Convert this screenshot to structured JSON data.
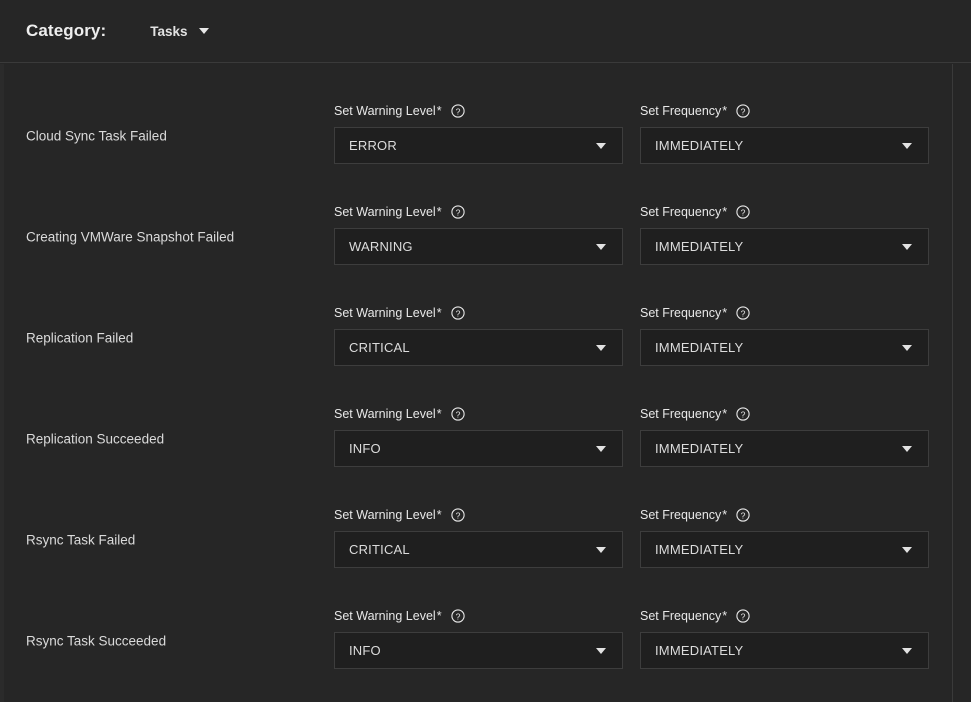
{
  "header": {
    "category_label": "Category:",
    "category_value": "Tasks",
    "caret_icon": "chevron-down-icon"
  },
  "columns": {
    "level_label": "Set Warning Level",
    "freq_label": "Set Frequency",
    "required_marker": "*",
    "help_icon": "help-circle-icon"
  },
  "colors": {
    "page_bg": "#262626",
    "field_bg": "#1f1f1f",
    "field_border": "#3d3d3d",
    "divider": "#3a3a3a",
    "text": "#dcdcdc"
  },
  "rows": [
    {
      "name": "Cloud Sync Task Failed",
      "level_label": "Set Warning Level",
      "level_value": "ERROR",
      "freq_label": "Set Frequency",
      "freq_value": "IMMEDIATELY"
    },
    {
      "name": "Creating VMWare Snapshot Failed",
      "level_label": "Set Warning Level",
      "level_value": "WARNING",
      "freq_label": "Set Frequency",
      "freq_value": "IMMEDIATELY"
    },
    {
      "name": "Replication Failed",
      "level_label": "Set Warning Level",
      "level_value": "CRITICAL",
      "freq_label": "Set Frequency",
      "freq_value": "IMMEDIATELY"
    },
    {
      "name": "Replication Succeeded",
      "level_label": "Set Warning Level",
      "level_value": "INFO",
      "freq_label": "Set Frequency",
      "freq_value": "IMMEDIATELY"
    },
    {
      "name": "Rsync Task Failed",
      "level_label": "Set Warning Level",
      "level_value": "CRITICAL",
      "freq_label": "Set Frequency",
      "freq_value": "IMMEDIATELY"
    },
    {
      "name": "Rsync Task Succeeded",
      "level_label": "Set Warning Level",
      "level_value": "INFO",
      "freq_label": "Set Frequency",
      "freq_value": "IMMEDIATELY"
    }
  ]
}
